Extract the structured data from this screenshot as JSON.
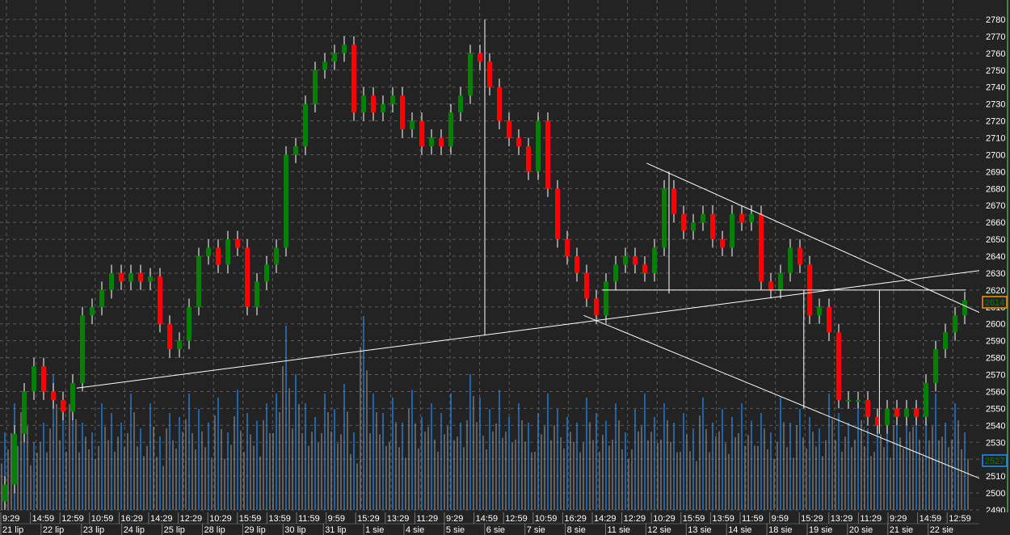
{
  "chart_data": {
    "type": "candlestick",
    "title": "",
    "ylim": [
      2486,
      2784
    ],
    "y_ticks": [
      2490,
      2500,
      2510,
      2520,
      2530,
      2540,
      2550,
      2560,
      2570,
      2580,
      2590,
      2600,
      2610,
      2620,
      2630,
      2640,
      2650,
      2660,
      2670,
      2680,
      2690,
      2700,
      2710,
      2720,
      2730,
      2740,
      2750,
      2760,
      2770,
      2780
    ],
    "first_open": 2495,
    "close": [
      2505,
      2535,
      2560,
      2575,
      2560,
      2555,
      2548,
      2565,
      2605,
      2610,
      2620,
      2630,
      2625,
      2630,
      2625,
      2628,
      2600,
      2585,
      2590,
      2610,
      2640,
      2645,
      2635,
      2650,
      2645,
      2610,
      2625,
      2635,
      2645,
      2700,
      2705,
      2730,
      2750,
      2755,
      2760,
      2765,
      2725,
      2735,
      2725,
      2730,
      2735,
      2715,
      2720,
      2705,
      2710,
      2705,
      2725,
      2735,
      2760,
      2755,
      2740,
      2720,
      2710,
      2705,
      2690,
      2720,
      2680,
      2650,
      2640,
      2630,
      2615,
      2605,
      2625,
      2635,
      2640,
      2635,
      2630,
      2645,
      2680,
      2665,
      2655,
      2660,
      2665,
      2650,
      2645,
      2665,
      2660,
      2665,
      2625,
      2620,
      2630,
      2645,
      2635,
      2605,
      2610,
      2595,
      2555,
      2555,
      2555,
      2545,
      2540,
      2550,
      2545,
      2550,
      2545,
      2565,
      2585,
      2595,
      2605,
      2614
    ],
    "volume": [
      40,
      55,
      60,
      35,
      45,
      70,
      50,
      65,
      45,
      40,
      55,
      50,
      45,
      60,
      42,
      55,
      38,
      50,
      48,
      60,
      52,
      45,
      58,
      40,
      62,
      50,
      46,
      55,
      60,
      95,
      70,
      55,
      48,
      60,
      52,
      65,
      40,
      100,
      60,
      50,
      58,
      45,
      62,
      48,
      55,
      50,
      60,
      45,
      70,
      58,
      52,
      62,
      48,
      55,
      45,
      50,
      60,
      52,
      48,
      45,
      58,
      50,
      46,
      55,
      40,
      52,
      60,
      48,
      55,
      45,
      50,
      42,
      58,
      45,
      52,
      48,
      55,
      46,
      50,
      40,
      58,
      45,
      52,
      48,
      42,
      60,
      50,
      45,
      55,
      42,
      50,
      45,
      52,
      48,
      55,
      46,
      60,
      45,
      55,
      40
    ],
    "last_price_label": "2614",
    "last_volume_label": "2527",
    "trendlines": [
      {
        "from": [
          7.4,
          2562
        ],
        "to": [
          101.2,
          2632
        ]
      },
      {
        "from": [
          66.2,
          2695
        ],
        "to": [
          101.2,
          2605
        ]
      },
      {
        "from": [
          59.7,
          2605
        ],
        "to": [
          100.8,
          2508
        ]
      },
      {
        "from": [
          61.6,
          2620
        ],
        "to": [
          99.1,
          2620
        ]
      },
      {
        "from": [
          49.5,
          2780
        ],
        "to": [
          49.5,
          2593
        ]
      },
      {
        "from": [
          68.5,
          2690
        ],
        "to": [
          68.5,
          2618
        ]
      },
      {
        "from": [
          82.4,
          2620
        ],
        "to": [
          82.4,
          2550
        ]
      },
      {
        "from": [
          90.2,
          2620
        ],
        "to": [
          90.2,
          2535
        ]
      }
    ],
    "time_labels": [
      "9:29",
      "14:59",
      "12:59",
      "10:59",
      "16:29",
      "14:29",
      "12:29",
      "10:29",
      "15:59",
      "13:59",
      "11:59",
      "9:59",
      "15:29",
      "13:29",
      "11:29",
      "9:29",
      "14:59",
      "12:59",
      "10:59",
      "16:29",
      "14:29",
      "12:29",
      "10:29",
      "15:59",
      "13:59",
      "11:59",
      "9:59",
      "15:29",
      "13:29",
      "11:29",
      "9:29",
      "14:59",
      "12:59"
    ],
    "date_labels": [
      "21 lip",
      "22 lip",
      "23 lip",
      "24 lip",
      "25 lip",
      "28 lip",
      "29 lip",
      "30 lip",
      "31 lip",
      "1 sie",
      "4 sie",
      "5 sie",
      "6 sie",
      "7 sie",
      "8 sie",
      "11 sie",
      "12 sie",
      "13 sie",
      "14 sie",
      "18 sie",
      "19 sie",
      "20 sie",
      "21 sie",
      "22 sie"
    ],
    "colors": {
      "up": "#008000",
      "down": "#ff0000",
      "wick": "#ffffff",
      "volume": "#1e90ff",
      "grid": "#5a5a5a",
      "background": "#232323",
      "price_badge": "#ff8c00",
      "volume_badge": "#1e90ff"
    }
  }
}
